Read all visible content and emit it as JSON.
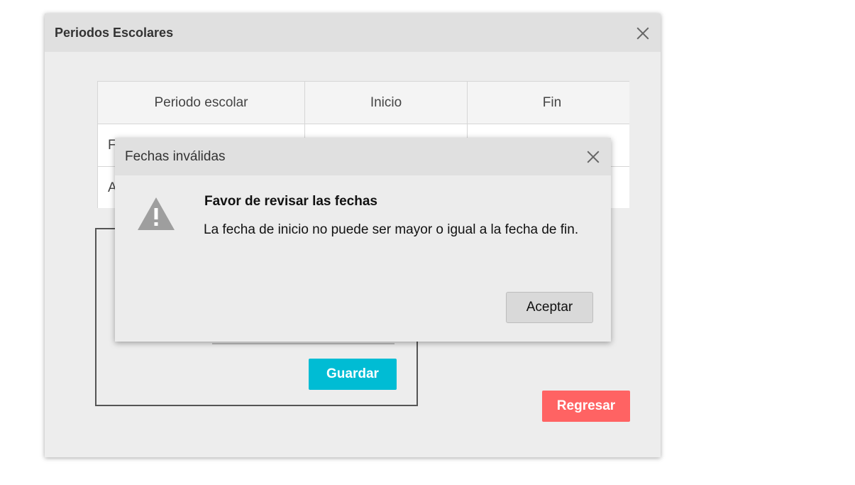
{
  "main_dialog": {
    "title": "Periodos Escolares",
    "close_icon": "close-icon"
  },
  "table": {
    "headers": [
      "Periodo escolar",
      "Inicio",
      "Fin"
    ],
    "rows": [
      [
        "F",
        "",
        ""
      ],
      [
        "A",
        "",
        ""
      ]
    ]
  },
  "form": {
    "save_label": "Guardar"
  },
  "back_label": "Regresar",
  "alert": {
    "title": "Fechas inválidas",
    "close_icon": "close-icon",
    "icon": "warning-icon",
    "heading": "Favor de revisar las fechas",
    "message": "La fecha de inicio no puede ser mayor o igual a la fecha de fin.",
    "accept_label": "Aceptar"
  },
  "colors": {
    "save_button": "#00bcd4",
    "back_button": "#ff6363",
    "warning_icon": "#9e9e9e"
  }
}
